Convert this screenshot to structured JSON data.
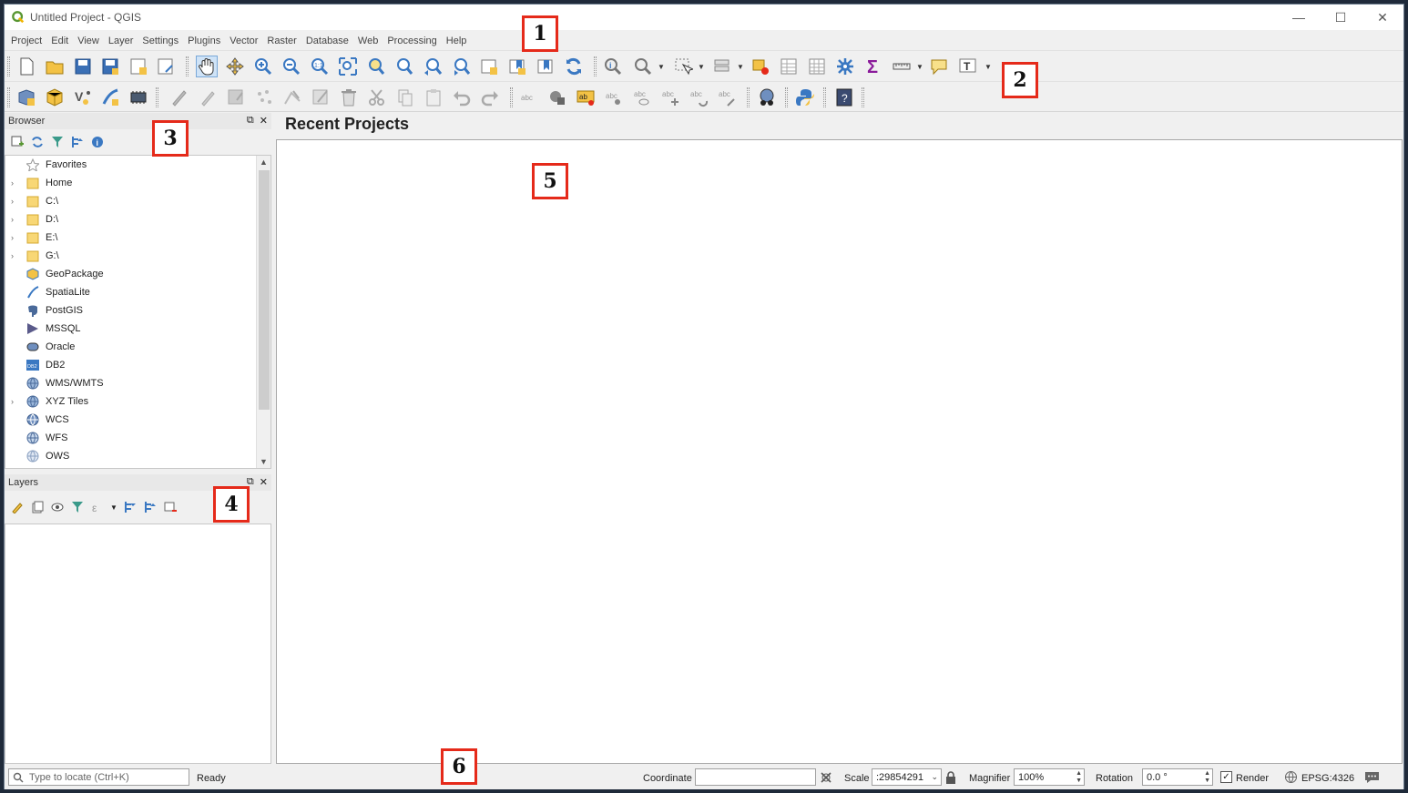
{
  "window": {
    "title": "Untitled Project - QGIS",
    "minimize": "—",
    "maximize": "☐",
    "close": "✕"
  },
  "menu": [
    "Project",
    "Edit",
    "View",
    "Layer",
    "Settings",
    "Plugins",
    "Vector",
    "Raster",
    "Database",
    "Web",
    "Processing",
    "Help"
  ],
  "browser": {
    "title": "Browser",
    "items": [
      "Favorites",
      "Home",
      "C:\\",
      "D:\\",
      "E:\\",
      "G:\\",
      "GeoPackage",
      "SpatiaLite",
      "PostGIS",
      "MSSQL",
      "Oracle",
      "DB2",
      "WMS/WMTS",
      "XYZ Tiles",
      "WCS",
      "WFS",
      "OWS"
    ]
  },
  "layers": {
    "title": "Layers"
  },
  "main": {
    "heading": "Recent Projects"
  },
  "status": {
    "locate_placeholder": "Type to locate (Ctrl+K)",
    "ready": "Ready",
    "coordinate_label": "Coordinate",
    "coordinate_value": "",
    "scale_label": "Scale",
    "scale_value": ":29854291",
    "magnifier_label": "Magnifier",
    "magnifier_value": "100%",
    "rotation_label": "Rotation",
    "rotation_value": "0.0 °",
    "render_label": "Render",
    "crs": "EPSG:4326"
  },
  "callouts": [
    "1",
    "2",
    "3",
    "4",
    "5",
    "6"
  ],
  "colors": {
    "callout": "#e52a1a",
    "qgis_green": "#589632",
    "accent_blue": "#3a78c2"
  }
}
